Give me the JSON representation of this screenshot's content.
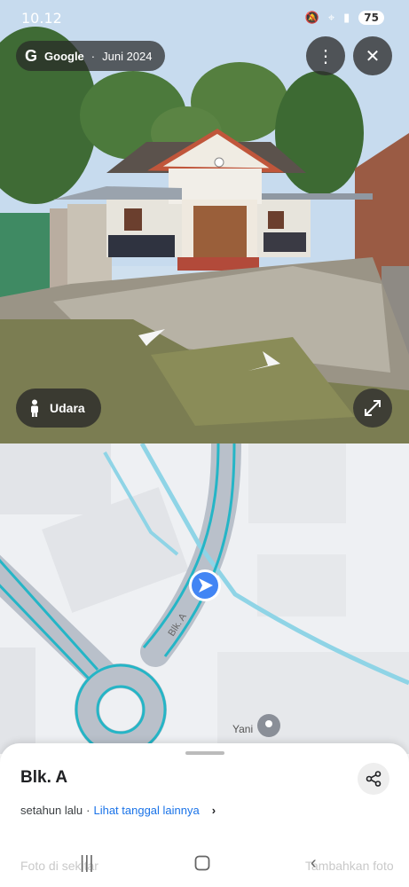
{
  "status_bar": {
    "time": "10.12",
    "battery": "75"
  },
  "attribution": {
    "brand": "Google",
    "separator": "·",
    "date": "Juni 2024",
    "logo_letter": "G"
  },
  "street_view": {
    "aerial_button_label": "Udara"
  },
  "map": {
    "road_label": "Blk. A",
    "poi_label": "Yani",
    "colors": {
      "route": "#25b5c6",
      "road": "#b9c0ca",
      "stream": "#8fd4e6",
      "you_are_here": "#4285f4"
    }
  },
  "sheet": {
    "title": "Blk. A",
    "updated_text": "setahun lalu",
    "separator": "·",
    "more_dates_link": "Lihat tanggal lainnya",
    "faded_left": "Foto di sekitar",
    "faded_right": "Tambahkan foto"
  },
  "icons": {
    "more": "more-vert-icon",
    "close": "close-icon",
    "person": "person-icon",
    "expand": "fullscreen-icon",
    "share": "share-icon",
    "chevron": "chevron-right-icon"
  }
}
